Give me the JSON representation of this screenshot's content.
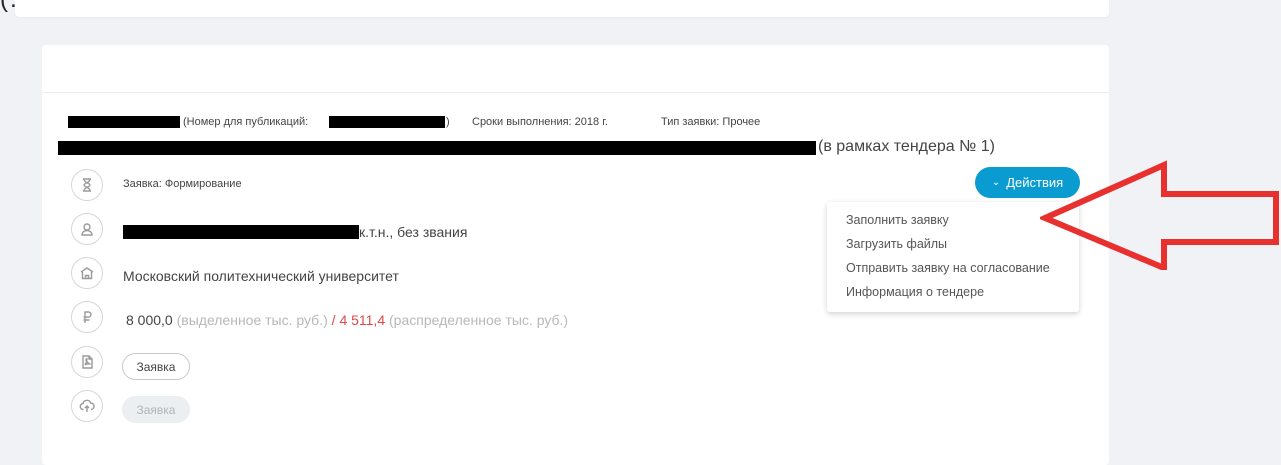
{
  "top_fragment": "(… ., …,…),",
  "tender": {
    "publication_label": "(Номер для публикаций:",
    "publication_close": ")",
    "deadline": "Сроки выполнения: 2018 г.",
    "type": "Тип заявки: Прочее",
    "tender_ref": "(в рамках тендера № 1)"
  },
  "status": "Заявка: Формирование",
  "person_suffix": "к.т.н., без звания",
  "organization": "Московский политехнический университет",
  "budget": {
    "allocated_value": "8 000,0",
    "allocated_label": "(выделенное тыс. руб.)",
    "separator": "/",
    "distributed_value": "4 511,4",
    "distributed_label": "(распределенное тыс. руб.)"
  },
  "file_pill": "Заявка",
  "upload_pill": "Заявка",
  "actions": {
    "label": "Действия",
    "menu": [
      "Заполнить заявку",
      "Загрузить файлы",
      "Отправить заявку на согласование",
      "Информация о тендере"
    ]
  },
  "colors": {
    "accent": "#0a9bd1",
    "danger": "#e04848",
    "annotation_arrow": "#e8312f"
  },
  "icons": [
    "hourglass-icon",
    "user-icon",
    "building-icon",
    "ruble-icon",
    "pdf-file-icon",
    "cloud-upload-icon",
    "chevron-down-icon"
  ]
}
